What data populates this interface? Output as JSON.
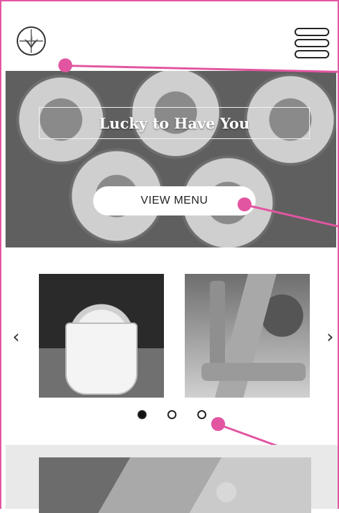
{
  "hero": {
    "title": "Lucky to Have You",
    "button_label": "VIEW MENU"
  },
  "carousel": {
    "prev_label": "‹",
    "next_label": "›",
    "slides": [
      {
        "name": "ice-cream-cup"
      },
      {
        "name": "bottled-drinks"
      }
    ],
    "active_index": 0,
    "dot_count": 3
  },
  "colors": {
    "annotation": "#e255a1",
    "text": "#222222",
    "button_bg": "#ffffff"
  },
  "icons": {
    "logo": "plant-logo-icon",
    "menu": "hamburger-menu-icon"
  }
}
